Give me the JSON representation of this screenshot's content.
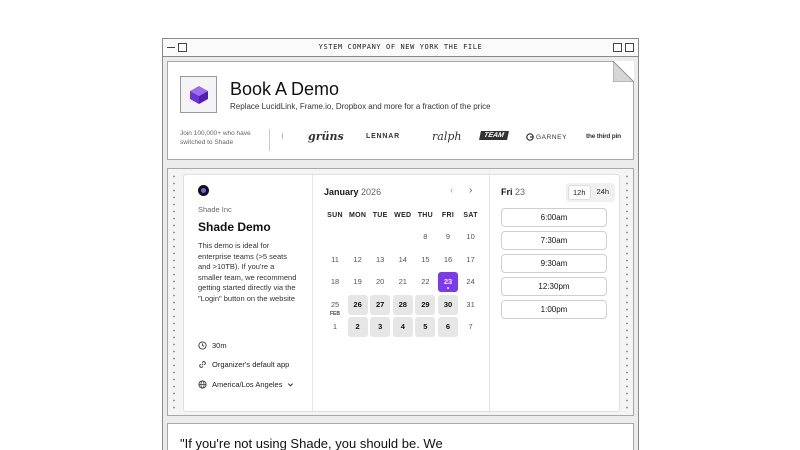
{
  "window": {
    "title": "YSTEM COMPANY OF NEW YORK  THE FILE"
  },
  "header": {
    "title": "Book A Demo",
    "subtitle": "Replace LucidLink, Frame.io, Dropbox and more for a fraction of the price",
    "social_proof": "Join 100,000+ who have switched to Shade",
    "customer_logos": [
      "grüns",
      "LENNAR",
      "ralph",
      "TEAM",
      "GARNEY",
      "the third pin"
    ]
  },
  "event": {
    "organizer": "Shade Inc",
    "title": "Shade Demo",
    "description": "This demo is ideal for enterprise teams (>5 seats and >10TB). If you're a smaller team, we recommend getting started directly via the \"Login\" button on the website",
    "duration": "30m",
    "location": "Organizer's default app",
    "timezone": "America/Los Angeles"
  },
  "calendar": {
    "month": "January",
    "year": "2026",
    "weekdays": [
      "SUN",
      "MON",
      "TUE",
      "WED",
      "THU",
      "FRI",
      "SAT"
    ],
    "weeks": [
      [
        {
          "d": ""
        },
        {
          "d": ""
        },
        {
          "d": ""
        },
        {
          "d": ""
        },
        {
          "d": "8"
        },
        {
          "d": "9"
        },
        {
          "d": "10"
        }
      ],
      [
        {
          "d": "11"
        },
        {
          "d": "12"
        },
        {
          "d": "13"
        },
        {
          "d": "14"
        },
        {
          "d": "15"
        },
        {
          "d": "16"
        },
        {
          "d": "17"
        }
      ],
      [
        {
          "d": "18"
        },
        {
          "d": "19"
        },
        {
          "d": "20"
        },
        {
          "d": "21"
        },
        {
          "d": "22"
        },
        {
          "d": "23",
          "state": "selected"
        },
        {
          "d": "24"
        }
      ],
      [
        {
          "d": "25"
        },
        {
          "d": "26",
          "state": "available"
        },
        {
          "d": "27",
          "state": "available"
        },
        {
          "d": "28",
          "state": "available"
        },
        {
          "d": "29",
          "state": "available"
        },
        {
          "d": "30",
          "state": "available"
        },
        {
          "d": "31"
        }
      ],
      [
        {
          "d": "1",
          "month": "FEB"
        },
        {
          "d": "2",
          "state": "available"
        },
        {
          "d": "3",
          "state": "available"
        },
        {
          "d": "4",
          "state": "available"
        },
        {
          "d": "5",
          "state": "available"
        },
        {
          "d": "6",
          "state": "available"
        },
        {
          "d": "7"
        }
      ]
    ]
  },
  "times": {
    "weekday": "Fri",
    "day": "23",
    "formats": [
      "12h",
      "24h"
    ],
    "active_format": "12h",
    "slots": [
      "6:00am",
      "7:30am",
      "9:30am",
      "12:30pm",
      "1:00pm"
    ]
  },
  "testimonial": {
    "text": "\"If you're not using Shade, you should be. We"
  }
}
